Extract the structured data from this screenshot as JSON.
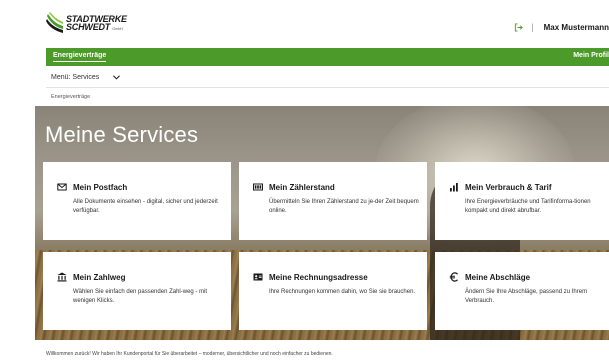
{
  "header": {
    "logo_line1": "STADTWERKE",
    "logo_line2": "SCHWEDT",
    "logo_suffix": "GmbH",
    "user_name": "Max Mustermann"
  },
  "nav": {
    "left_label": "Energieverträge",
    "right_label": "Mein Profil"
  },
  "submenu": {
    "label": "Menü: Services"
  },
  "breadcrumb": "Energieverträge",
  "hero": {
    "title": "Meine Services"
  },
  "cards": [
    {
      "icon": "mail-icon",
      "title": "Mein Postfach",
      "desc": "Alle Dokumente einsehen - digital, sicher und jederzeit verfügbar."
    },
    {
      "icon": "meter-icon",
      "title": "Mein Zählerstand",
      "desc": "Übermitteln Sie Ihren Zählerstand zu je-der Zeit bequem online."
    },
    {
      "icon": "bar-chart-icon",
      "title": "Mein Verbrauch & Tarif",
      "desc": "Ihre Energieverbräuche und Tarifinforma-tionen kompakt und direkt abrufbar."
    },
    {
      "icon": "bank-icon",
      "title": "Mein Zahlweg",
      "desc": "Wählen Sie einfach den passenden Zahl-weg - mit wenigen Klicks."
    },
    {
      "icon": "address-card-icon",
      "title": "Meine Rechnungsadresse",
      "desc": "Ihre Rechnungen kommen dahin, wo Sie sie brauchen."
    },
    {
      "icon": "euro-icon",
      "title": "Meine Abschläge",
      "desc": "Ändern Sie Ihre Abschläge, passend zu Ihrem Verbrauch."
    }
  ],
  "footer": {
    "text": "Willkommen zurück! Wir haben Ihr Kundenportal für Sie überarbeitet – moderner, übersichtlicher und noch einfacher zu bedienen."
  },
  "colors": {
    "brand_green": "#4c9a2a",
    "hero_text": "#ffffff"
  }
}
